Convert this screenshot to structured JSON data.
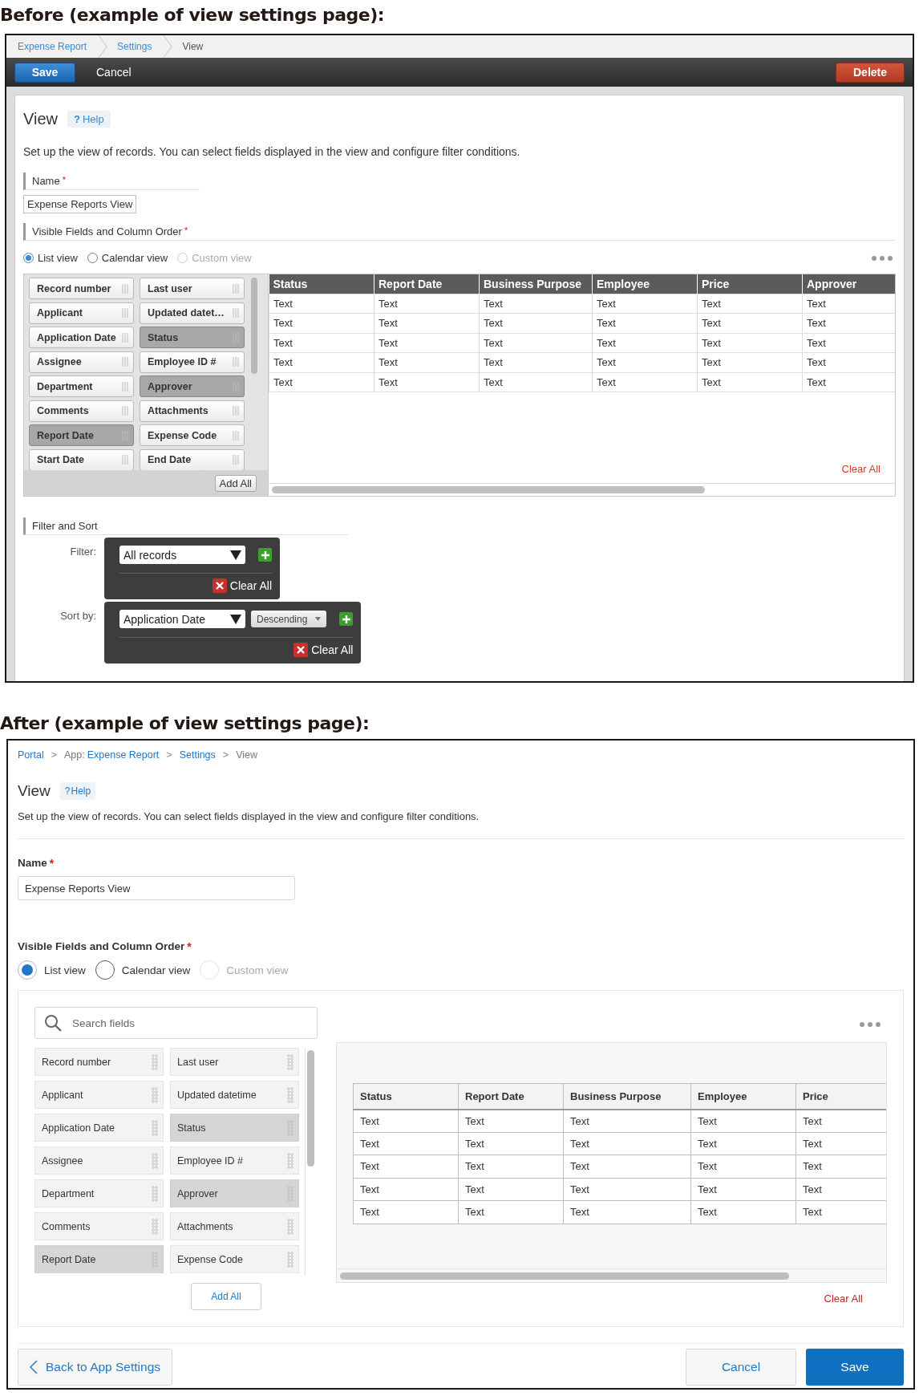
{
  "before": {
    "heading": "Before (example of view settings page):",
    "breadcrumbs": [
      {
        "text": "Expense Report",
        "kind": "link"
      },
      {
        "text": "Settings",
        "kind": "link"
      },
      {
        "text": "View",
        "kind": "current"
      }
    ],
    "toolbar": {
      "save": "Save",
      "cancel": "Cancel",
      "delete": "Delete"
    },
    "title": "View",
    "help_mark": "?",
    "help": "Help",
    "description": "Set up the view of records. You can select fields displayed in the view and configure filter conditions.",
    "name_label": "Name",
    "name_required": "*",
    "name_value": "Expense Reports View",
    "fields_label": "Visible Fields and Column Order",
    "fields_required": "*",
    "view_types": [
      {
        "label": "List view",
        "selected": true,
        "disabled": false
      },
      {
        "label": "Calendar view",
        "selected": false,
        "disabled": false
      },
      {
        "label": "Custom view",
        "selected": false,
        "disabled": true
      }
    ],
    "fields": [
      {
        "label": "Record number",
        "added": false
      },
      {
        "label": "Last user",
        "added": false
      },
      {
        "label": "Applicant",
        "added": false
      },
      {
        "label": "Updated datet…",
        "added": false
      },
      {
        "label": "Application Date",
        "added": false
      },
      {
        "label": "Status",
        "added": true
      },
      {
        "label": "Assignee",
        "added": false
      },
      {
        "label": "Employee ID #",
        "added": false
      },
      {
        "label": "Department",
        "added": false
      },
      {
        "label": "Approver",
        "added": true
      },
      {
        "label": "Comments",
        "added": false
      },
      {
        "label": "Attachments",
        "added": false
      },
      {
        "label": "Report Date",
        "added": true
      },
      {
        "label": "Expense Code",
        "added": false
      },
      {
        "label": "Start Date",
        "added": false
      },
      {
        "label": "End Date",
        "added": false
      }
    ],
    "add_all": "Add All",
    "columns": [
      "Status",
      "Report Date",
      "Business Purpose",
      "Employee",
      "Price",
      "Approver"
    ],
    "rows": [
      [
        "Text",
        "Text",
        "Text",
        "Text",
        "Text",
        "Text"
      ],
      [
        "Text",
        "Text",
        "Text",
        "Text",
        "Text",
        "Text"
      ],
      [
        "Text",
        "Text",
        "Text",
        "Text",
        "Text",
        "Text"
      ],
      [
        "Text",
        "Text",
        "Text",
        "Text",
        "Text",
        "Text"
      ],
      [
        "Text",
        "Text",
        "Text",
        "Text",
        "Text",
        "Text"
      ]
    ],
    "clear_all": "Clear All",
    "filter_heading": "Filter and Sort",
    "filter": {
      "label": "Filter:",
      "value": "All records",
      "clear": "Clear All"
    },
    "sort": {
      "label": "Sort by:",
      "value": "Application Date",
      "order": "Descending",
      "clear": "Clear All"
    }
  },
  "after": {
    "heading": "After (example of view settings page):",
    "breadcrumbs": [
      {
        "text": "Portal",
        "kind": "link"
      },
      {
        "text": ">",
        "kind": "sep"
      },
      {
        "text": "App:",
        "kind": "plain"
      },
      {
        "text": "Expense Report",
        "kind": "link"
      },
      {
        "text": ">",
        "kind": "sep"
      },
      {
        "text": "Settings",
        "kind": "link"
      },
      {
        "text": ">",
        "kind": "sep"
      },
      {
        "text": "View",
        "kind": "current"
      }
    ],
    "title": "View",
    "help_mark": "?",
    "help": "Help",
    "description": "Set up the view of records. You can select fields displayed in the view and configure filter conditions.",
    "name_label": "Name",
    "name_required": "*",
    "name_value": "Expense Reports View",
    "fields_label": "Visible Fields and Column Order",
    "fields_required": "*",
    "view_types": [
      {
        "label": "List view",
        "selected": true,
        "disabled": false
      },
      {
        "label": "Calendar view",
        "selected": false,
        "disabled": false
      },
      {
        "label": "Custom view",
        "selected": false,
        "disabled": true
      }
    ],
    "search_placeholder": "Search fields",
    "fields": [
      {
        "label": "Record number",
        "added": false
      },
      {
        "label": "Last user",
        "added": false
      },
      {
        "label": "Applicant",
        "added": false
      },
      {
        "label": "Updated datetime",
        "added": false
      },
      {
        "label": "Application Date",
        "added": false
      },
      {
        "label": "Status",
        "added": true
      },
      {
        "label": "Assignee",
        "added": false
      },
      {
        "label": "Employee ID #",
        "added": false
      },
      {
        "label": "Department",
        "added": false
      },
      {
        "label": "Approver",
        "added": true
      },
      {
        "label": "Comments",
        "added": false
      },
      {
        "label": "Attachments",
        "added": false
      },
      {
        "label": "Report Date",
        "added": true
      },
      {
        "label": "Expense Code",
        "added": false
      }
    ],
    "add_all": "Add All",
    "columns": [
      "Status",
      "Report Date",
      "Business Purpose",
      "Employee",
      "Price"
    ],
    "rows": [
      [
        "Text",
        "Text",
        "Text",
        "Text",
        "Text"
      ],
      [
        "Text",
        "Text",
        "Text",
        "Text",
        "Text"
      ],
      [
        "Text",
        "Text",
        "Text",
        "Text",
        "Text"
      ],
      [
        "Text",
        "Text",
        "Text",
        "Text",
        "Text"
      ],
      [
        "Text",
        "Text",
        "Text",
        "Text",
        "Text"
      ]
    ],
    "clear_all": "Clear All",
    "back": "Back to App Settings",
    "cancel": "Cancel",
    "save": "Save"
  }
}
